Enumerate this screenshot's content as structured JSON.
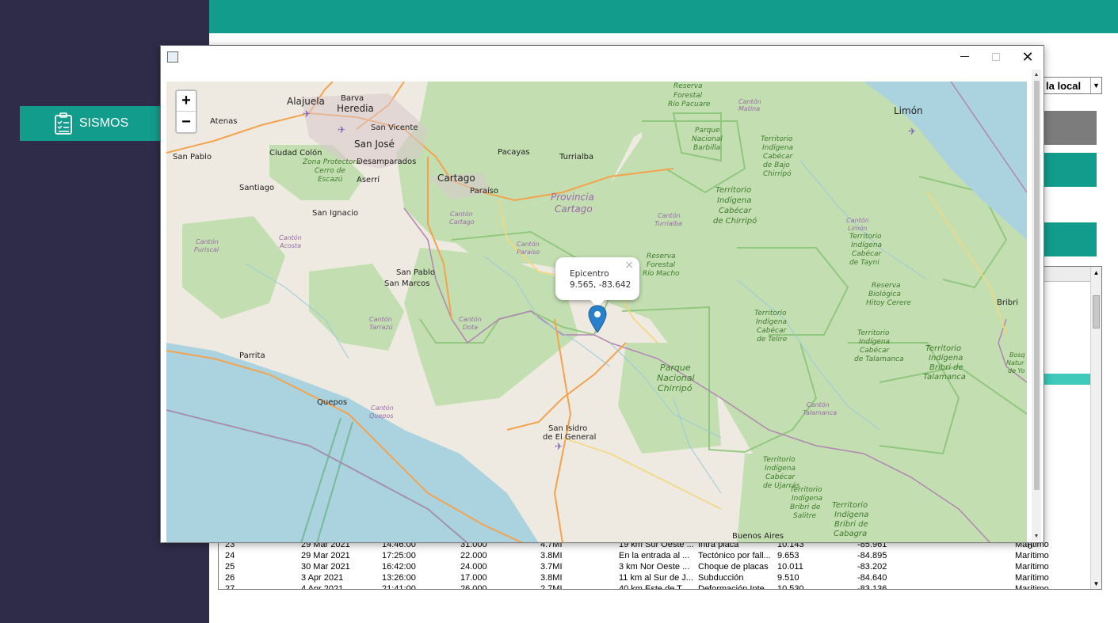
{
  "sidebar": {
    "menu_label": "SISMOS",
    "menu_icon": "clipboard-checklist-icon"
  },
  "controls": {
    "time_select_value": "la local"
  },
  "table": {
    "rows": [
      {
        "num": "23",
        "date": "29 Mar 2021",
        "time": "14:46:00",
        "depth": "31.000",
        "magnitude": "4.7MI",
        "location": "19 km Sur Oeste ...",
        "origin": "Intra placa",
        "lat": "10.143",
        "lon": "-85.961",
        "zone": "Marítimo"
      },
      {
        "num": "24",
        "date": "29 Mar 2021",
        "time": "17:25:00",
        "depth": "22.000",
        "magnitude": "3.8MI",
        "location": "En la entrada al ...",
        "origin": "Tectónico por fall...",
        "lat": "9.653",
        "lon": "-84.895",
        "zone": "Marítimo"
      },
      {
        "num": "25",
        "date": "30 Mar 2021",
        "time": "16:42:00",
        "depth": "24.000",
        "magnitude": "3.7MI",
        "location": "3 km Nor Oeste ...",
        "origin": "Choque de placas",
        "lat": "10.011",
        "lon": "-83.202",
        "zone": "Marítimo"
      },
      {
        "num": "26",
        "date": "3 Apr 2021",
        "time": "13:26:00",
        "depth": "17.000",
        "magnitude": "3.8MI",
        "location": "11 km al Sur de J...",
        "origin": "Subducción",
        "lat": "9.510",
        "lon": "-84.640",
        "zone": "Marítimo"
      },
      {
        "num": "27",
        "date": "4 Apr 2021",
        "time": "21:41:00",
        "depth": "26.000",
        "magnitude": "2.7MI",
        "location": "40 km Este de T...",
        "origin": "Deformación Inte...",
        "lat": "10.530",
        "lon": "-83.136",
        "zone": "Marítimo"
      }
    ],
    "visible_fragments": [
      "o",
      "re",
      "o",
      "o",
      "re",
      "re",
      "o",
      "o",
      "re",
      "o",
      "re",
      "re",
      "o",
      "re",
      "re",
      "re",
      "re",
      "o",
      "re",
      "re",
      "o",
      "re",
      "re",
      "o"
    ],
    "selected_fragment_index": 8
  },
  "map_window": {
    "close_symbol": "✕",
    "zoom_in": "+",
    "zoom_out": "−",
    "popup": {
      "title": "Epicentro",
      "coords": "9.565, -83.642",
      "close": "×"
    },
    "labels": {
      "alajuela": "Alajuela",
      "barva": "Barva",
      "heredia": "Heredia",
      "atenas": "Atenas",
      "san_vicente": "San Vicente",
      "san_jose": "San José",
      "ciudad_colon": "Ciudad Colón",
      "desamparados": "Desamparados",
      "san_pablo": "San Pablo",
      "aserri": "Aserrí",
      "santiago": "Santiago",
      "cartago": "Cartago",
      "paraiso": "Paraíso",
      "pacayas": "Pacayas",
      "turrialba": "Turrialba",
      "san_ignacio": "San Ignacio",
      "san_pablo_2": "San Pablo",
      "san_marcos": "San Marcos",
      "parrita": "Parrita",
      "quepos": "Quepos",
      "san_isidro_1": "San Isidro",
      "san_isidro_2": "de El General",
      "buenos_aires": "Buenos Aires",
      "limon": "Limón",
      "bribri": "Bribri",
      "prov_cartago_1": "Provincia",
      "prov_cartago_2": "Cartago",
      "pn_chirripo_1": "Parque",
      "pn_chirripo_2": "Nacional",
      "pn_chirripo_3": "Chirripó",
      "pn_barbilla_1": "Parque",
      "pn_barbilla_2": "Nacional",
      "pn_barbilla_3": "Barbilla",
      "rf_pacuare_1": "Reserva",
      "rf_pacuare_2": "Forestal",
      "rf_pacuare_3": "Río Pacuare",
      "rf_macho_1": "Reserva",
      "rf_macho_2": "Forestal",
      "rf_macho_3": "Río Macho",
      "zp_escazu_1": "Zona Protectora",
      "zp_escazu_2": "Cerro de",
      "zp_escazu_3": "Escazú",
      "rb_hitoy_1": "Reserva",
      "rb_hitoy_2": "Biológica",
      "rb_hitoy_3": "Hitoy Cerere",
      "ti_chirripo_1": "Territorio",
      "ti_chirripo_2": "Indígena",
      "ti_chirripo_3": "Cabécar",
      "ti_chirripo_4": "de Chirripó",
      "ti_talamanca_1": "Territorio",
      "ti_talamanca_2": "Indígena",
      "ti_talamanca_3": "Bribri de",
      "ti_talamanca_4": "Talamanca",
      "ti_cabagra_1": "Territorio",
      "ti_cabagra_2": "Indígena",
      "ti_cabagra_3": "Bribri de",
      "ti_cabagra_4": "Cabagra",
      "ti_bajo_1": "Territorio",
      "ti_bajo_2": "Indígena",
      "ti_bajo_3": "Cabécar",
      "ti_bajo_4": "de Bajo",
      "ti_bajo_5": "Chirripó",
      "ti_tayni_1": "Territorio",
      "ti_tayni_2": "Indígena",
      "ti_tayni_3": "Cabécar",
      "ti_tayni_4": "de Tayni",
      "ti_telire_1": "Territorio",
      "ti_telire_2": "Indígena",
      "ti_telire_3": "Cabécar",
      "ti_telire_4": "de Telire",
      "ti_ctal_1": "Territorio",
      "ti_ctal_2": "Indígena",
      "ti_ctal_3": "Cabécar",
      "ti_ctal_4": "de Talamanca",
      "ti_ujarras_1": "Territorio",
      "ti_ujarras_2": "Indígena",
      "ti_ujarras_3": "Cabécar",
      "ti_ujarras_4": "de Ujarrás",
      "ti_salitre_1": "Territorio",
      "ti_salitre_2": "Indígena",
      "ti_salitre_3": "Bribri de",
      "ti_salitre_4": "Salitre",
      "c_matina_1": "Cantón",
      "c_matina_2": "Matina",
      "c_cartago_1": "Cantón",
      "c_cartago_2": "Cartago",
      "c_turrialba_1": "Cantón",
      "c_turrialba_2": "Turrialba",
      "c_paraiso_1": "Cantón",
      "c_paraiso_2": "Paraíso",
      "c_limon_1": "Cantón",
      "c_limon_2": "Limón",
      "c_puriscal_1": "Cantón",
      "c_puriscal_2": "Puriscal",
      "c_acosta_1": "Cantón",
      "c_acosta_2": "Acosta",
      "c_tarrazu_1": "Cantón",
      "c_tarrazu_2": "Tarrazú",
      "c_dota_1": "Cantón",
      "c_dota_2": "Dota",
      "c_quepos_1": "Cantón",
      "c_quepos_2": "Quepos",
      "c_talamanca_1": "Cantón",
      "c_talamanca_2": "Talamanca",
      "bosque_1": "Bosq",
      "bosque_2": "Natur",
      "bosque_3": "de Yo"
    }
  },
  "colors": {
    "sidebar": "#2e2c48",
    "accent": "#129c8c",
    "selection": "#3ec9bb",
    "water": "#aad3df",
    "forest": "#c3dfb1",
    "land": "#eeeae1",
    "marker": "#2a81cb"
  }
}
